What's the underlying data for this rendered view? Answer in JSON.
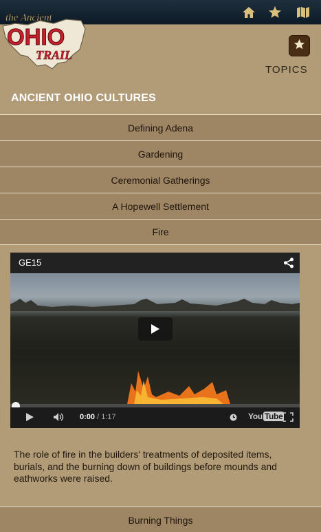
{
  "header": {
    "icons": [
      "home-icon",
      "star-icon",
      "map-icon"
    ],
    "icon_color": "#d9bf79",
    "logo": {
      "line1": "the Ancient",
      "line2": "OHIO",
      "line3": "TRAIL"
    }
  },
  "topics": {
    "label": "TOPICS",
    "icon": "star-icon"
  },
  "section_title": "ANCIENT OHIO CULTURES",
  "topic_items": [
    {
      "label": "Defining Adena"
    },
    {
      "label": "Gardening"
    },
    {
      "label": "Ceremonial Gatherings"
    },
    {
      "label": "A Hopewell Settlement"
    },
    {
      "label": "Fire"
    }
  ],
  "video": {
    "title": "GE15",
    "current_time": "0:00",
    "separator": " / ",
    "duration": "1:17",
    "brand_prefix": "You",
    "brand_suffix": "Tube",
    "progress": 0
  },
  "description": "The role of fire in the builders' treatments of deposited items, burials, and the burning down of buildings before mounds and eathworks were raised.",
  "bottom_item": {
    "label": "Burning Things"
  },
  "colors": {
    "background": "#b19c77",
    "list_item": "#9e8563",
    "topics_button": "#4a2e14",
    "logo_red": "#c8202a"
  }
}
